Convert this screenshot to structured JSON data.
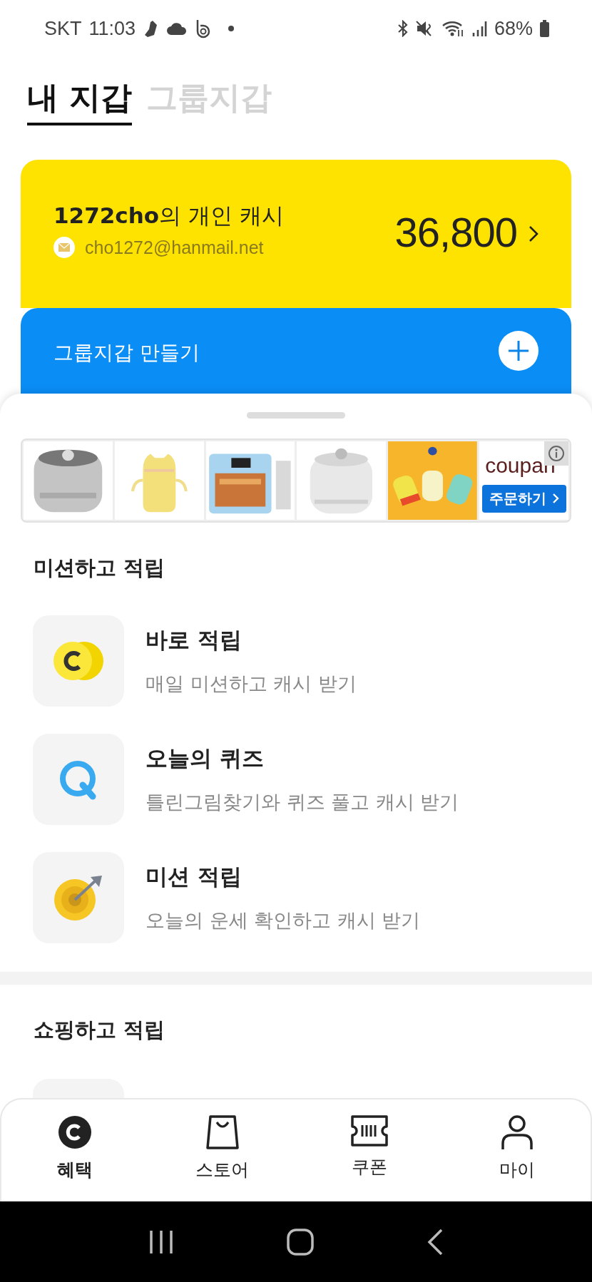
{
  "status_bar": {
    "carrier": "SKT",
    "time": "11:03",
    "battery": "68%"
  },
  "tabs": [
    {
      "label": "내 지갑",
      "selected": true
    },
    {
      "label": "그룹지갑",
      "selected": false
    }
  ],
  "cash_card": {
    "title": "**1272cho**의 개인 캐시",
    "email": "cho1272@hanmail.net",
    "amount": "36,800"
  },
  "group_card": {
    "label": "그룹지갑 만들기"
  },
  "ad": {
    "logo": "coupan",
    "button": "주문하기"
  },
  "sections": [
    {
      "title": "미션하고 적립",
      "items": [
        {
          "kind": "coin",
          "title": "바로 적립",
          "subtitle": "매일 미션하고 캐시 받기"
        },
        {
          "kind": "quiz",
          "title": "오늘의 퀴즈",
          "subtitle": "틀린그림찾기와 퀴즈 풀고 캐시 받기"
        },
        {
          "kind": "target",
          "title": "미션 적립",
          "subtitle": "오늘의 운세 확인하고 캐시 받기"
        }
      ]
    },
    {
      "title": "쇼핑하고 적립"
    }
  ],
  "bottom_nav": [
    {
      "kind": "coin",
      "label": "혜택",
      "selected": true
    },
    {
      "kind": "bag",
      "label": "스토어",
      "selected": false
    },
    {
      "kind": "ticket",
      "label": "쿠폰",
      "selected": false
    },
    {
      "kind": "person",
      "label": "마이",
      "selected": false
    }
  ]
}
